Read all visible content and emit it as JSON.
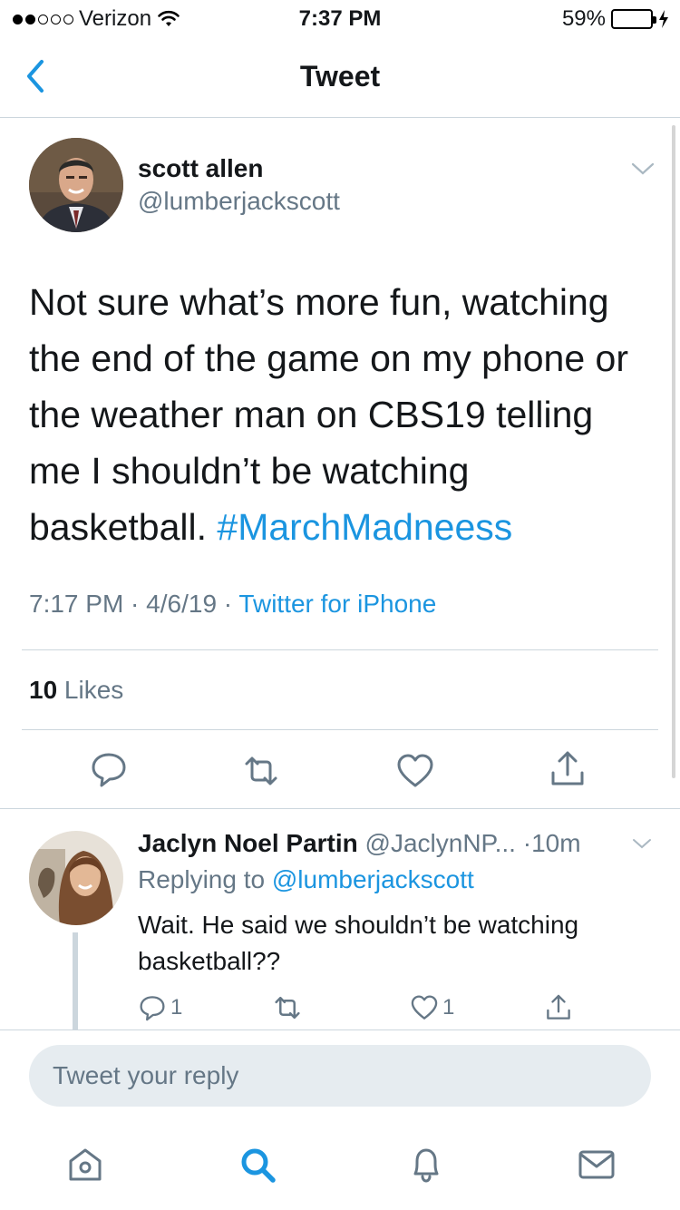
{
  "status_bar": {
    "carrier": "Verizon",
    "time": "7:37 PM",
    "battery": "59%",
    "battery_level": 0.59,
    "signal_bars_filled": 2,
    "signal_bars_total": 5
  },
  "nav": {
    "title": "Tweet",
    "back_icon": "chevron-left-icon"
  },
  "tweet": {
    "author_name": "scott allen",
    "author_handle": "@lumberjackscott",
    "text": "Not sure what’s more fun, watching the end of the game on my phone or the weather man on CBS19 telling me I shouldn’t be watching basketball. ",
    "hashtag": "#MarchMadneess",
    "time": "7:17 PM",
    "sep1": " · ",
    "date": "4/6/19",
    "sep2": " · ",
    "source": "Twitter for iPhone",
    "likes_count": "10",
    "likes_label": " Likes"
  },
  "reply": {
    "name": "Jaclyn Noel Partin",
    "handle": " @JaclynNP...",
    "time": " ·10m",
    "replying_prefix": "Replying to ",
    "replying_to": "@lumberjackscott",
    "text": "Wait. He said we shouldn’t be watching basketball??",
    "reply_count": "1",
    "like_count": "1"
  },
  "compose": {
    "placeholder": "Tweet your reply"
  },
  "tabbar": {
    "items": [
      "home-icon",
      "search-icon",
      "notifications-icon",
      "messages-icon"
    ],
    "active": "search-icon"
  },
  "colors": {
    "accent": "#1b95e0",
    "muted": "#657786",
    "divider": "#ccd6dd",
    "battery": "#f5c400"
  }
}
